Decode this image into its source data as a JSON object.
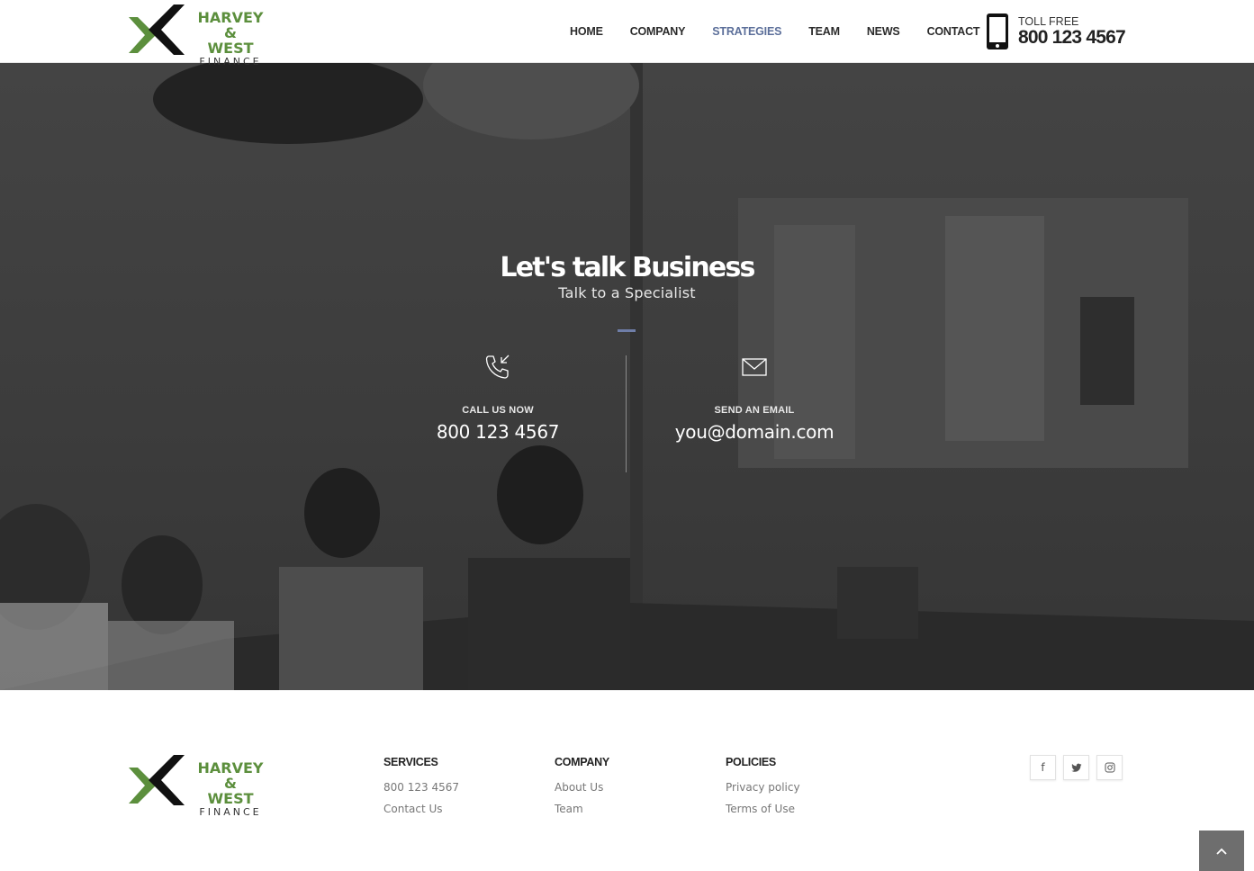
{
  "brand": {
    "line1": "HARVEY &",
    "line2": "WEST",
    "line3": "FINANCE",
    "green": "#5c8f3d",
    "dark": "#111111"
  },
  "nav": {
    "items": [
      {
        "label": "HOME"
      },
      {
        "label": "COMPANY"
      },
      {
        "label": "STRATEGIES",
        "active": true
      },
      {
        "label": "TEAM"
      },
      {
        "label": "NEWS"
      },
      {
        "label": "CONTACT"
      }
    ],
    "active_color": "#5c6f9a"
  },
  "toll": {
    "label": "TOLL FREE",
    "number": "800 123 4567",
    "icon": "smartphone-icon"
  },
  "hero": {
    "title": "Let's talk Business",
    "subtitle": "Talk to a Specialist",
    "call": {
      "icon": "phone-incoming-icon",
      "label": "CALL US NOW",
      "value": "800 123 4567"
    },
    "email": {
      "icon": "envelope-icon",
      "label": "SEND AN EMAIL",
      "value": "you@domain.com"
    },
    "accent": "#6f7ea8"
  },
  "footer": {
    "services": {
      "heading": "SERVICES",
      "links": [
        "800 123 4567",
        "Contact Us"
      ]
    },
    "company": {
      "heading": "COMPANY",
      "links": [
        "About Us",
        "Team"
      ]
    },
    "policies": {
      "heading": "POLICIES",
      "links": [
        "Privacy policy",
        "Terms of Use"
      ]
    },
    "socials": [
      {
        "icon": "facebook-icon",
        "glyph": "f"
      },
      {
        "icon": "twitter-icon",
        "glyph": "t"
      },
      {
        "icon": "instagram-icon",
        "glyph": "◎"
      }
    ],
    "back_to_top_icon": "chevron-up-icon"
  }
}
